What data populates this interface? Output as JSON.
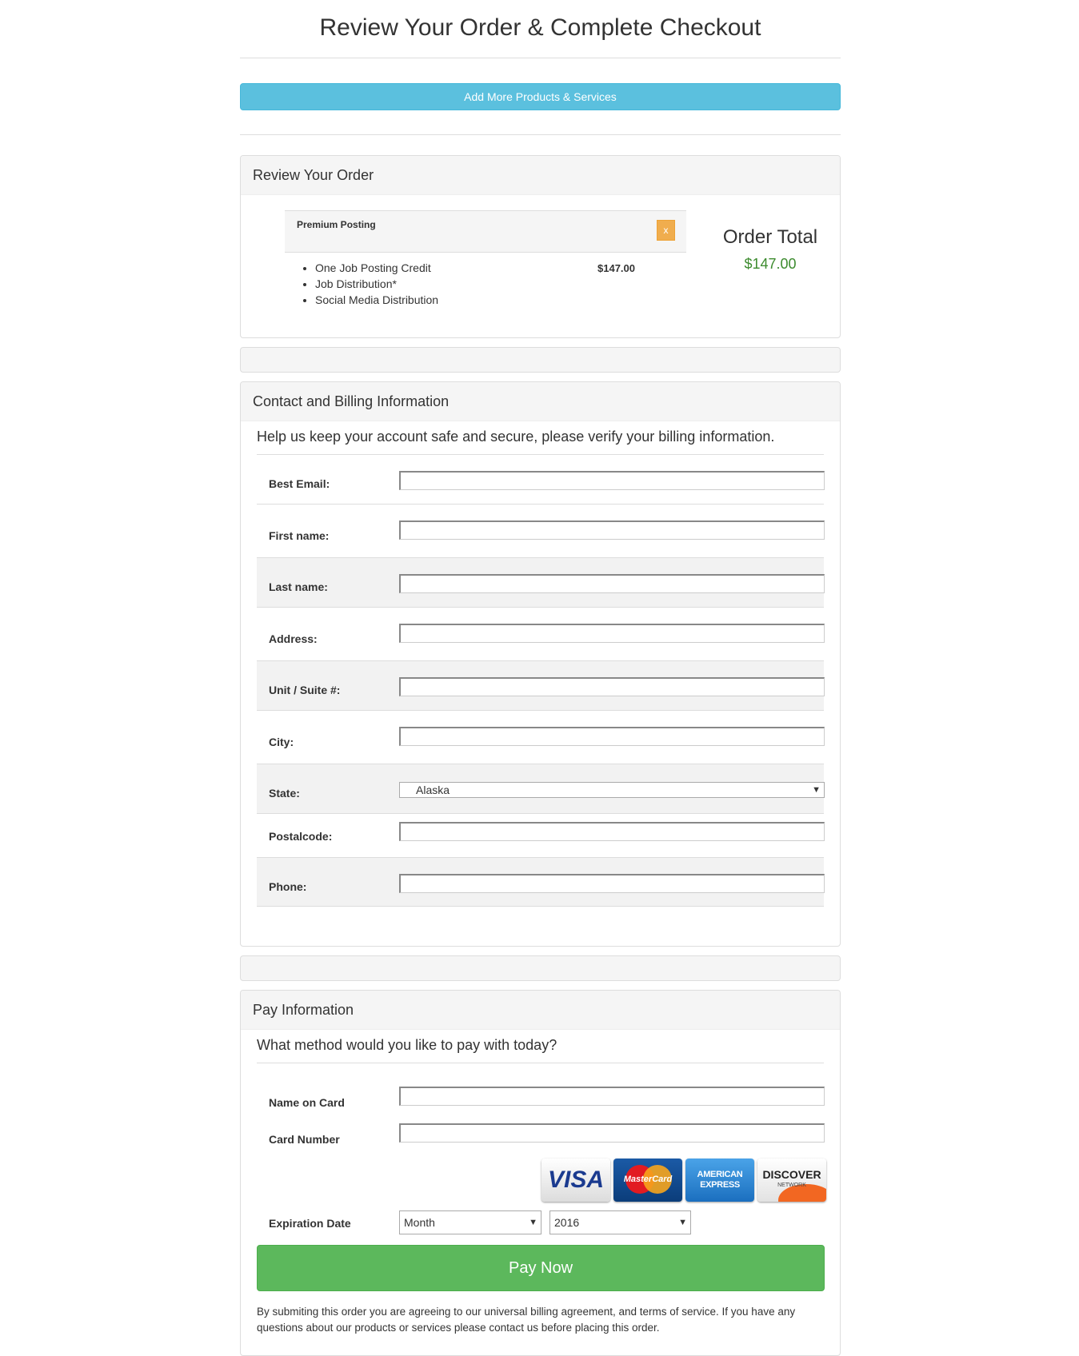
{
  "page": {
    "title": "Review Your Order & Complete Checkout",
    "add_more_label": "Add More Products & Services"
  },
  "review": {
    "heading": "Review Your Order",
    "item": {
      "name": "Premium Posting",
      "remove_label": "x",
      "features": [
        "One Job Posting Credit",
        "Job Distribution*",
        "Social Media Distribution"
      ],
      "price": "$147.00"
    },
    "total_label": "Order Total",
    "total_value": "$147.00"
  },
  "billing": {
    "heading": "Contact and Billing Information",
    "intro": "Help us keep your account safe and secure, please verify your billing information.",
    "fields": [
      {
        "label": "Best Email:",
        "value": ""
      },
      {
        "label": "First name:",
        "value": ""
      },
      {
        "label": "Last name:",
        "value": ""
      },
      {
        "label": "Address:",
        "value": ""
      },
      {
        "label": "Unit / Suite #:",
        "value": ""
      },
      {
        "label": "City:",
        "value": ""
      },
      {
        "label": "State:",
        "value": "Alaska"
      },
      {
        "label": "Postalcode:",
        "value": ""
      },
      {
        "label": "Phone:",
        "value": ""
      }
    ]
  },
  "payment": {
    "heading": "Pay Information",
    "intro": "What method would you like to pay with today?",
    "name_on_card_label": "Name on Card",
    "card_number_label": "Card Number",
    "cards": {
      "visa": "VISA",
      "mastercard": "MasterCard",
      "amex_line1": "AMERICAN",
      "amex_line2": "EXPRESS",
      "discover": "DISCOVER",
      "discover_sub": "NETWORK"
    },
    "expiration_label": "Expiration Date",
    "month_value": "Month",
    "year_value": "2016",
    "pay_now_label": "Pay Now",
    "legal": "By submiting this order you are agreeing to our universal billing agreement, and terms of service. If you have any questions about our products or services please contact us before placing this order."
  },
  "colors": {
    "info": "#5bc0de",
    "success": "#5cb85c",
    "warning": "#f0ad4e",
    "total_green": "#3c8b2e"
  }
}
